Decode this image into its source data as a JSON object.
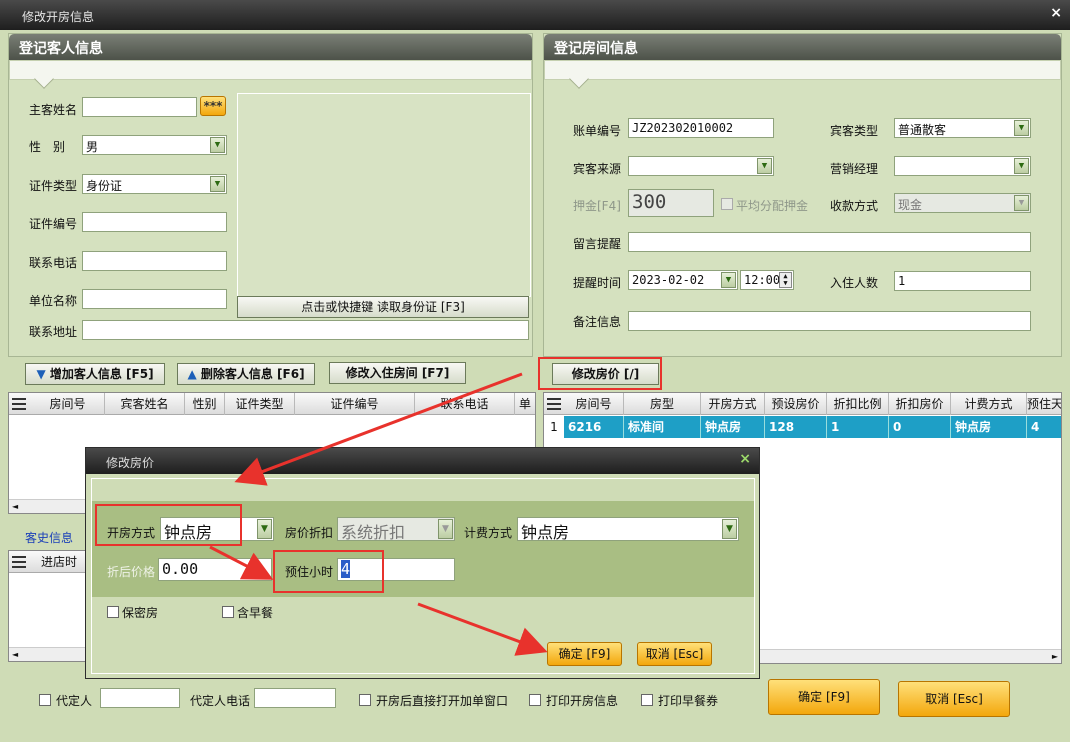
{
  "window": {
    "title": "修改开房信息",
    "close": "×"
  },
  "guest_panel": {
    "title": "登记客人信息",
    "main_name_label": "主客姓名",
    "dots_button": "***",
    "gender_label": "性　别",
    "gender_value": "男",
    "id_type_label": "证件类型",
    "id_type_value": "身份证",
    "id_no_label": "证件编号",
    "phone_label": "联系电话",
    "company_label": "单位名称",
    "address_label": "联系地址",
    "read_id_button": "点击或快捷键 读取身份证 [F3]"
  },
  "room_panel": {
    "title": "登记房间信息",
    "bill_no_label": "账单编号",
    "bill_no_value": "JZ202302010002",
    "guest_type_label": "宾客类型",
    "guest_type_value": "普通散客",
    "source_label": "宾客来源",
    "sales_label": "营销经理",
    "deposit_label": "押金[F4]",
    "deposit_value": "300",
    "avg_deposit_label": "平均分配押金",
    "pay_method_label": "收款方式",
    "pay_method_value": "现金",
    "message_label": "留言提醒",
    "remind_time_label": "提醒时间",
    "remind_date": "2023-02-02",
    "remind_clock": "12:00",
    "guests_count_label": "入住人数",
    "guests_count_value": "1",
    "note_label": "备注信息"
  },
  "actions": {
    "add_guest": "增加客人信息 [F5]",
    "delete_guest": "删除客人信息 [F6]",
    "modify_room": "修改入住房间 [F7]",
    "modify_price": "修改房价 [/]"
  },
  "guest_table": {
    "headers": [
      "房间号",
      "宾客姓名",
      "性别",
      "证件类型",
      "证件编号",
      "联系电话",
      "单"
    ]
  },
  "room_table": {
    "headers": [
      "房间号",
      "房型",
      "开房方式",
      "预设房价",
      "折扣比例",
      "折扣房价",
      "计费方式",
      "预住天"
    ],
    "rows": [
      {
        "index": "1",
        "cells": [
          "6216",
          "标准间",
          "钟点房",
          "128",
          "1",
          "0",
          "钟点房",
          "4"
        ]
      }
    ]
  },
  "history": {
    "label": "客史信息",
    "header": "进店时"
  },
  "footer": {
    "proxy_label": "代定人",
    "proxy_phone_label": "代定人电话",
    "open_bill_label": "开房后直接打开加单窗口",
    "print_open_label": "打印开房信息",
    "print_breakfast_label": "打印早餐券",
    "ok": "确定 [F9]",
    "cancel": "取消 [Esc]"
  },
  "dialog": {
    "title": "修改房价",
    "close": "×",
    "open_mode_label": "开房方式",
    "open_mode_value": "钟点房",
    "discount_label": "房价折扣",
    "discount_value": "系统折扣",
    "billing_label": "计费方式",
    "billing_value": "钟点房",
    "after_price_label": "折后价格",
    "after_price_value": "0.00",
    "hours_label": "预住小时",
    "hours_value": "4",
    "private_label": "保密房",
    "breakfast_label": "含早餐",
    "ok": "确定 [F9]",
    "cancel": "取消 [Esc]"
  },
  "colors": {
    "annotation": "#e8322c",
    "selected_row": "#1e9fc6",
    "accent_button": "#f3a70c"
  }
}
